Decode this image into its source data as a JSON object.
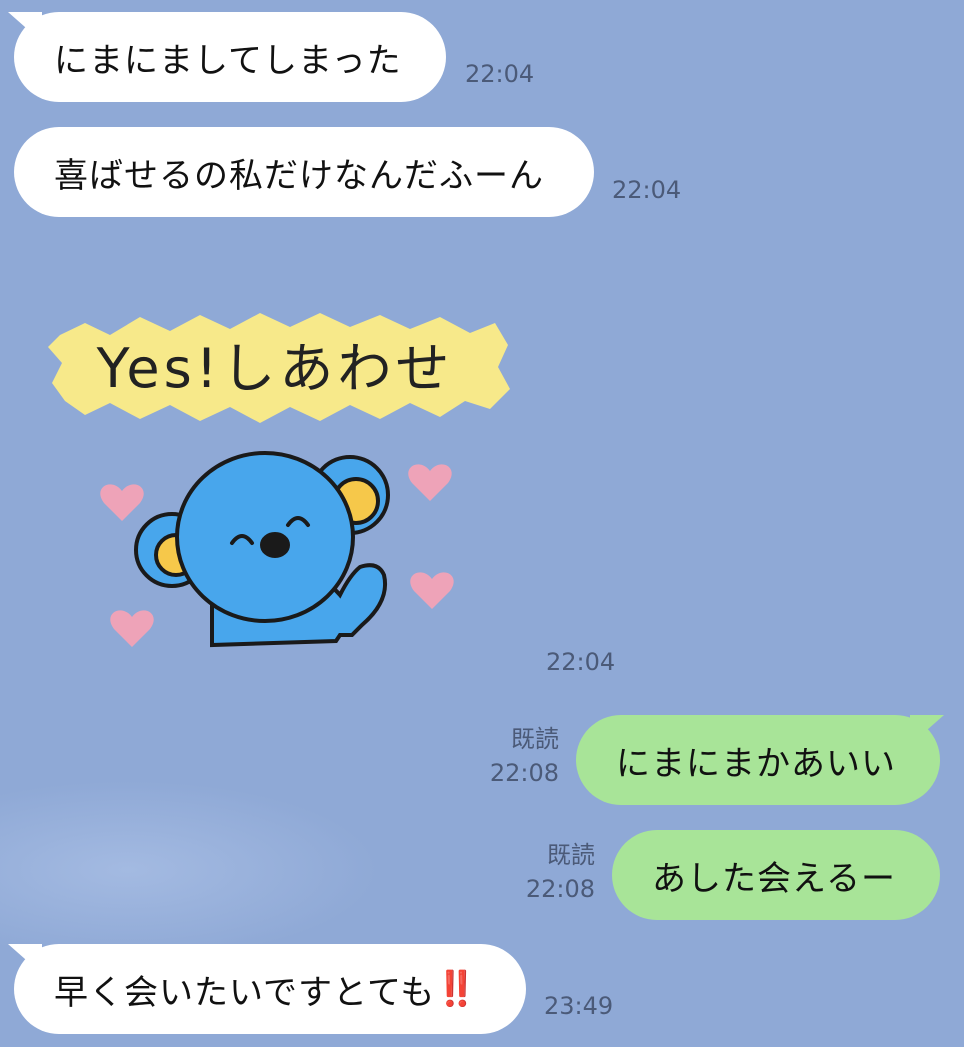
{
  "messages": [
    {
      "side": "in",
      "text": "にまにましてしまった",
      "time": "22:04"
    },
    {
      "side": "in",
      "text": "喜ばせるの私だけなんだふーん",
      "time": "22:04"
    },
    {
      "side": "in",
      "type": "sticker",
      "sticker_text": "Yes!しあわせ",
      "time": "22:04"
    },
    {
      "side": "out",
      "text": "にまにまかあいい",
      "read": "既読",
      "time": "22:08"
    },
    {
      "side": "out",
      "text": "あした会えるー",
      "read": "既読",
      "time": "22:08"
    },
    {
      "side": "in",
      "text": "早く会いたいですとても",
      "emoji": "‼️",
      "time": "23:49"
    }
  ],
  "colors": {
    "background": "#8fa9d6",
    "incoming_bubble": "#ffffff",
    "outgoing_bubble": "#a8e498",
    "timestamp": "#4b5a78"
  }
}
